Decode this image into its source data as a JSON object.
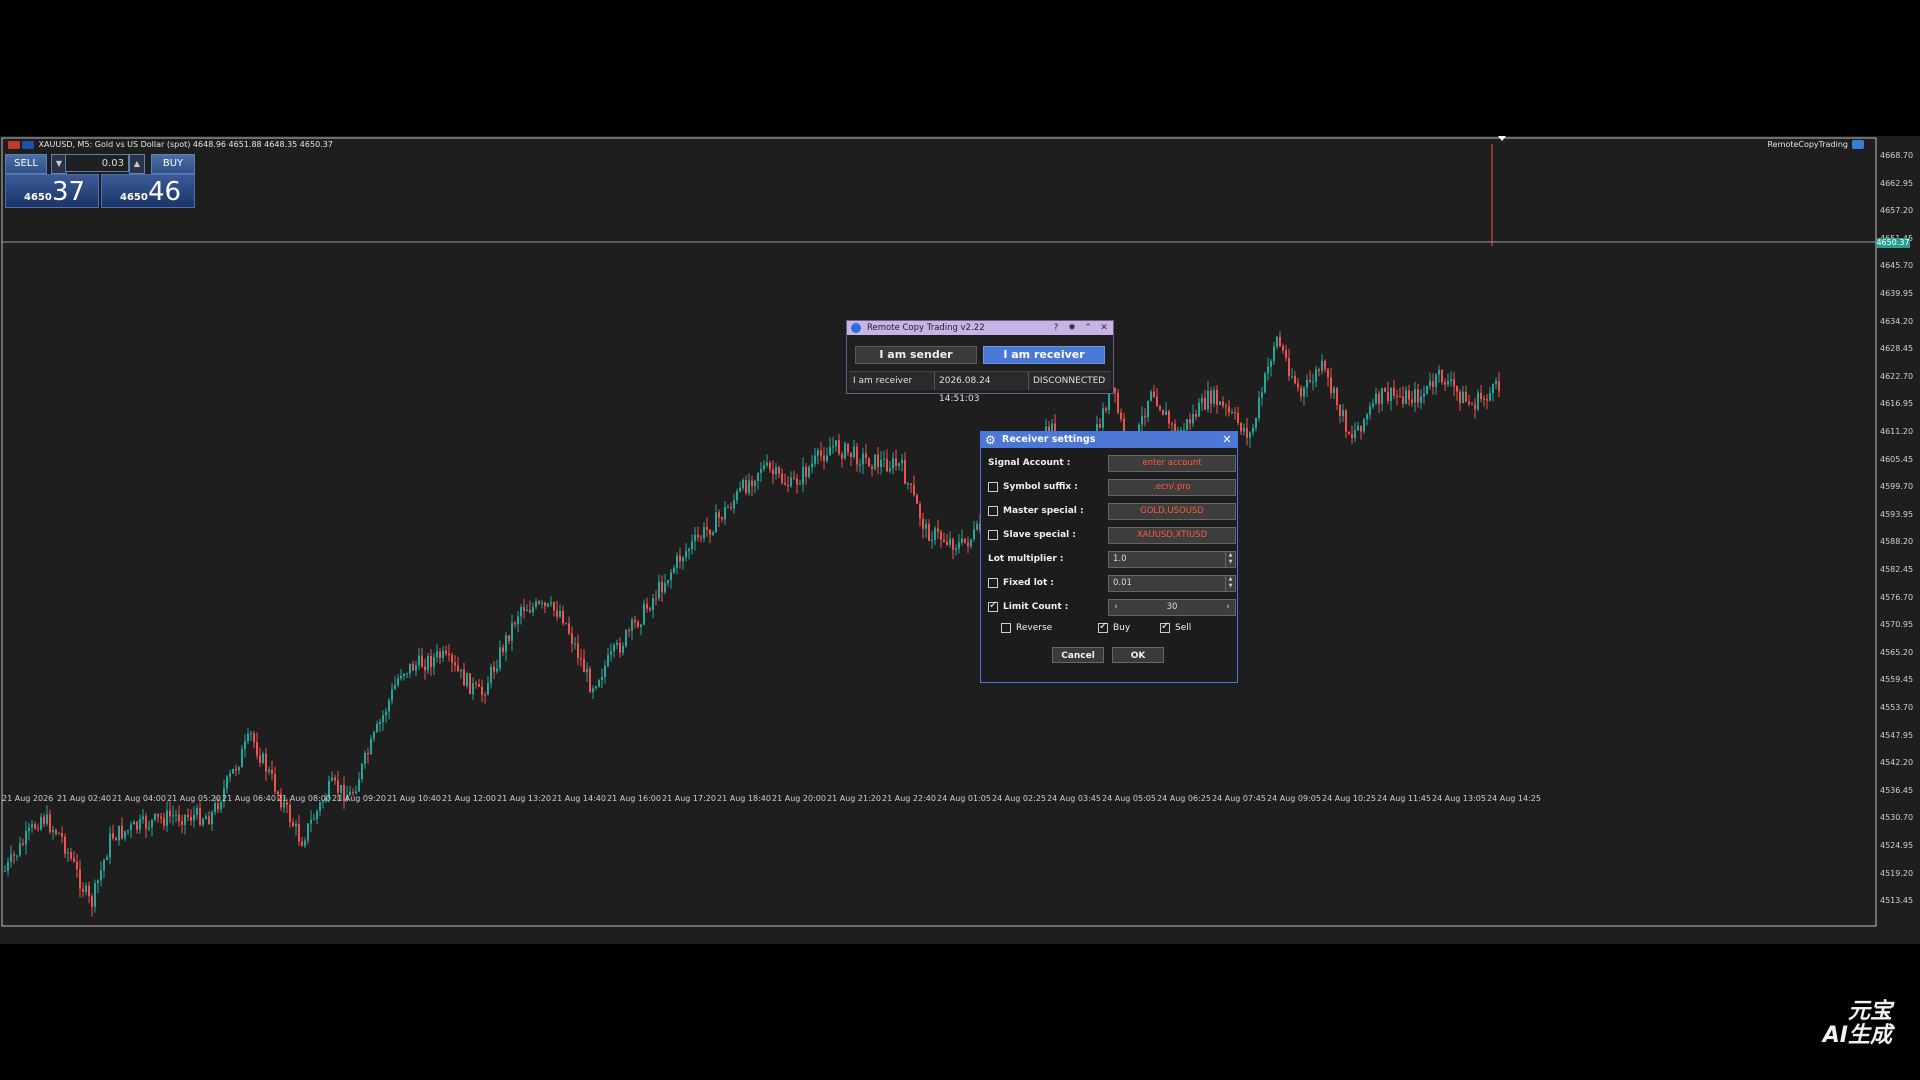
{
  "chart": {
    "title": "XAUUSD, M5:  Gold vs US Dollar (spot)  4648.96 4651.88 4648.35 4650.37",
    "ea_name": "RemoteCopyTrading",
    "current_price": "4650.37",
    "price_axis": [
      "4668.70",
      "4662.95",
      "4657.20",
      "4651.45",
      "4645.70",
      "4639.95",
      "4634.20",
      "4628.45",
      "4622.70",
      "4616.95",
      "4611.20",
      "4605.45",
      "4599.70",
      "4593.95",
      "4588.20",
      "4582.45",
      "4576.70",
      "4570.95",
      "4565.20",
      "4559.45",
      "4553.70",
      "4547.95",
      "4542.20",
      "4536.45",
      "4530.70",
      "4524.95",
      "4519.20",
      "4513.45"
    ],
    "time_axis": [
      "21 Aug 2026",
      "21 Aug 02:40",
      "21 Aug 04:00",
      "21 Aug 05:20",
      "21 Aug 06:40",
      "21 Aug 08:00",
      "21 Aug 09:20",
      "21 Aug 10:40",
      "21 Aug 12:00",
      "21 Aug 13:20",
      "21 Aug 14:40",
      "21 Aug 16:00",
      "21 Aug 17:20",
      "21 Aug 18:40",
      "21 Aug 20:00",
      "21 Aug 21:20",
      "21 Aug 22:40",
      "24 Aug 01:05",
      "24 Aug 02:25",
      "24 Aug 03:45",
      "24 Aug 05:05",
      "24 Aug 06:25",
      "24 Aug 07:45",
      "24 Aug 09:05",
      "24 Aug 10:25",
      "24 Aug 11:45",
      "24 Aug 13:05",
      "24 Aug 14:25"
    ],
    "bull_color": "#26a69a",
    "bear_color": "#ef5350"
  },
  "trade_panel": {
    "sell_label": "SELL",
    "buy_label": "BUY",
    "lot": "0.03",
    "sell_price_small": "4650",
    "sell_price_big": "37",
    "buy_price_small": "4650",
    "buy_price_big": "46"
  },
  "rct": {
    "title": "Remote Copy Trading v2.22",
    "help": "?",
    "sender_label": "I am sender",
    "receiver_label": "I am receiver",
    "status_role": "I am receiver",
    "status_time": "2026.08.24 14:51:03",
    "status_conn": "DISCONNECTED"
  },
  "receiver": {
    "title": "Receiver settings",
    "signal_account_label": "Signal Account :",
    "signal_account_value": "enter account",
    "symbol_suffix_label": "Symbol suffix :",
    "symbol_suffix_value": ".ecn/.pro",
    "master_special_label": "Master special :",
    "master_special_value": "GOLD,USOUSD",
    "slave_special_label": "Slave special :",
    "slave_special_value": "XAUUSD,XTIUSD",
    "lot_multiplier_label": "Lot multiplier :",
    "lot_multiplier_value": "1.0",
    "fixed_lot_label": "Fixed lot :",
    "fixed_lot_value": "0.01",
    "limit_count_label": "Limit Count :",
    "limit_count_value": "30",
    "reverse_label": "Reverse",
    "buy_label": "Buy",
    "sell_label": "Sell",
    "cancel_label": "Cancel",
    "ok_label": "OK",
    "checks": {
      "symbol_suffix": false,
      "master_special": false,
      "slave_special": false,
      "fixed_lot": false,
      "limit_count": true,
      "reverse": false,
      "buy": true,
      "sell": true
    }
  },
  "watermark": {
    "line1": "元宝",
    "line2": "AI生成"
  }
}
